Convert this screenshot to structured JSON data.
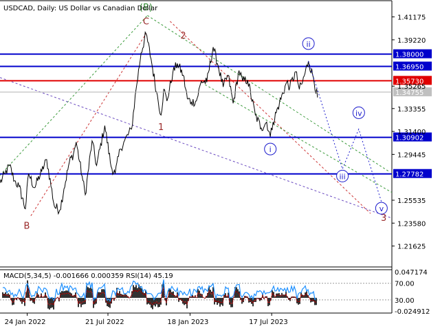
{
  "window": {
    "title": "USDCAD, Daily:  US Dollar vs Canadian Dollar"
  },
  "colors": {
    "price_line": "#000000",
    "blue_level": "#0000cc",
    "red_level": "#e00000",
    "current_price_label": "#c0c0c0",
    "wave_blue": "#1a1acc",
    "wave_red": "#9a2a2a",
    "wave_green": "#2e8b2e",
    "channel_green": "#3a9a3a",
    "channel_purple": "#6a4ac0",
    "channel_red": "#cc3333",
    "macd_hist": "#000000",
    "macd_signal": "#cc0000",
    "rsi_line": "#1e90ff"
  },
  "chart_data": [
    {
      "type": "line",
      "title": "USDCAD, Daily:  US Dollar vs Canadian Dollar",
      "instrument": "USDCAD",
      "timeframe": "Daily",
      "x_ticks": [
        "24 Jan 2022",
        "21 Jul 2022",
        "18 Jan 2023",
        "17 Jul 2023"
      ],
      "xlim": [
        "2021-11-25",
        "2024-04-07"
      ],
      "y_ticks": [
        "1.41175",
        "1.39220",
        "1.35265",
        "1.33355",
        "1.31400",
        "1.29445",
        "1.25535",
        "1.23580",
        "1.21625"
      ],
      "ylim": [
        1.1984,
        1.425
      ],
      "series": [
        {
          "points": [
            [
              "2021-11-25",
              1.27
            ],
            [
              "2021-12-06",
              1.278
            ],
            [
              "2021-12-16",
              1.285
            ],
            [
              "2021-12-27",
              1.272
            ],
            [
              "2022-01-06",
              1.267
            ],
            [
              "2022-01-20",
              1.248
            ],
            [
              "2022-01-27",
              1.278
            ],
            [
              "2022-02-09",
              1.266
            ],
            [
              "2022-02-25",
              1.28
            ],
            [
              "2022-03-08",
              1.29
            ],
            [
              "2022-03-25",
              1.25
            ],
            [
              "2022-04-06",
              1.247
            ],
            [
              "2022-04-15",
              1.265
            ],
            [
              "2022-04-27",
              1.288
            ],
            [
              "2022-05-06",
              1.295
            ],
            [
              "2022-05-12",
              1.305
            ],
            [
              "2022-05-25",
              1.276
            ],
            [
              "2022-06-01",
              1.26
            ],
            [
              "2022-06-16",
              1.306
            ],
            [
              "2022-06-26",
              1.285
            ],
            [
              "2022-07-14",
              1.319
            ],
            [
              "2022-07-28",
              1.284
            ],
            [
              "2022-08-06",
              1.278
            ],
            [
              "2022-08-17",
              1.299
            ],
            [
              "2022-08-25",
              1.305
            ],
            [
              "2022-09-11",
              1.316
            ],
            [
              "2022-09-21",
              1.35
            ],
            [
              "2022-10-02",
              1.381
            ],
            [
              "2022-10-13",
              1.3975
            ],
            [
              "2022-10-24",
              1.376
            ],
            [
              "2022-11-05",
              1.348
            ],
            [
              "2022-11-15",
              1.328
            ],
            [
              "2022-11-21",
              1.35
            ],
            [
              "2022-11-28",
              1.34
            ],
            [
              "2022-12-11",
              1.364
            ],
            [
              "2022-12-21",
              1.372
            ],
            [
              "2023-01-03",
              1.362
            ],
            [
              "2023-01-12",
              1.342
            ],
            [
              "2023-01-21",
              1.339
            ],
            [
              "2023-02-01",
              1.34
            ],
            [
              "2023-02-12",
              1.357
            ],
            [
              "2023-02-24",
              1.356
            ],
            [
              "2023-03-10",
              1.386
            ],
            [
              "2023-03-21",
              1.37
            ],
            [
              "2023-04-01",
              1.352
            ],
            [
              "2023-04-12",
              1.362
            ],
            [
              "2023-04-23",
              1.338
            ],
            [
              "2023-05-06",
              1.366
            ],
            [
              "2023-05-14",
              1.357
            ],
            [
              "2023-05-25",
              1.358
            ],
            [
              "2023-06-11",
              1.328
            ],
            [
              "2023-06-24",
              1.317
            ],
            [
              "2023-07-06",
              1.322
            ],
            [
              "2023-07-14",
              1.3095
            ],
            [
              "2023-07-20",
              1.322
            ],
            [
              "2023-08-03",
              1.338
            ],
            [
              "2023-08-19",
              1.356
            ],
            [
              "2023-08-26",
              1.352
            ],
            [
              "2023-09-08",
              1.365
            ],
            [
              "2023-09-16",
              1.35
            ],
            [
              "2023-09-23",
              1.356
            ],
            [
              "2023-10-06",
              1.374
            ],
            [
              "2023-10-17",
              1.36
            ],
            [
              "2023-10-26",
              1.343
            ]
          ]
        }
      ],
      "current_price": "1.34755",
      "horizontal_levels": [
        {
          "label": "1.38000",
          "value": 1.38,
          "color": "#0000cc",
          "width": 2
        },
        {
          "label": "1.36950",
          "value": 1.3695,
          "color": "#0000cc",
          "width": 2
        },
        {
          "label": "1.35730",
          "value": 1.3573,
          "color": "#e00000",
          "width": 2
        },
        {
          "label": "1.30902",
          "value": 1.30902,
          "color": "#0000cc",
          "width": 2
        },
        {
          "label": "1.27782",
          "value": 1.27782,
          "color": "#0000cc",
          "width": 2
        }
      ],
      "trend_lines": [
        {
          "from": [
            "2021-11-25",
            1.2765
          ],
          "to": [
            "2022-10-16",
            1.413
          ],
          "color": "#3a9a3a"
        },
        {
          "from": [
            "2022-10-16",
            1.413
          ],
          "to": [
            "2024-03-31",
            1.28
          ],
          "color": "#3a9a3a"
        },
        {
          "from": [
            "2021-11-25",
            1.36
          ],
          "to": [
            "2024-04-07",
            1.24
          ],
          "color": "#6a4ac0"
        },
        {
          "from": [
            "2022-02-01",
            1.242
          ],
          "to": [
            "2022-10-13",
            1.3975
          ],
          "color": "#cc3333"
        },
        {
          "from": [
            "2022-12-05",
            1.408
          ],
          "to": [
            "2024-02-20",
            1.244
          ],
          "color": "#cc3333"
        },
        {
          "from": [
            "2023-02-20",
            1.354
          ],
          "to": [
            "2024-04-07",
            1.262
          ],
          "color": "#3a9a3a"
        }
      ],
      "forecast_path": [
        [
          "2023-10-06",
          1.374
        ],
        [
          "2023-12-20",
          1.282
        ],
        [
          "2024-01-25",
          1.316
        ],
        [
          "2024-03-15",
          1.254
        ]
      ],
      "wave_labels": [
        {
          "text": "(B)",
          "x": "2022-10-13",
          "y": 1.42,
          "color": "#2e8b2e",
          "circled": false
        },
        {
          "text": "C",
          "x": "2022-10-13",
          "y": 1.408,
          "color": "#9a2a2a",
          "circled": false
        },
        {
          "text": "2",
          "x": "2023-01-03",
          "y": 1.396,
          "color": "#9a2a2a",
          "circled": false
        },
        {
          "text": "1",
          "x": "2022-11-15",
          "y": 1.318,
          "color": "#9a2a2a",
          "circled": false
        },
        {
          "text": "B",
          "x": "2022-01-23",
          "y": 1.2335,
          "color": "#9a2a2a",
          "circled": false
        },
        {
          "text": "3",
          "x": "2024-03-20",
          "y": 1.2405,
          "color": "#9a2a2a",
          "circled": false
        },
        {
          "text": "i",
          "x": "2023-07-14",
          "y": 1.299,
          "color": "#1a1acc",
          "circled": true
        },
        {
          "text": "ii",
          "x": "2023-10-06",
          "y": 1.389,
          "color": "#1a1acc",
          "circled": true
        },
        {
          "text": "iii",
          "x": "2023-12-20",
          "y": 1.276,
          "color": "#1a1acc",
          "circled": true
        },
        {
          "text": "iv",
          "x": "2024-01-25",
          "y": 1.33,
          "color": "#1a1acc",
          "circled": true
        },
        {
          "text": "v",
          "x": "2024-03-15",
          "y": 1.2485,
          "color": "#1a1acc",
          "circled": true
        }
      ]
    },
    {
      "type": "bar",
      "title": "MACD(5,34,5) -0.001666 0.000359 RSI(14) 45.19",
      "indicator": "MACD(5,34,5)",
      "macd_value": "-0.001666",
      "signal_value": "0.000359",
      "rsi_label": "RSI(14) 45.19",
      "y_ticks": [
        "0.047174",
        "70.00",
        "30.00",
        "-0.024912"
      ],
      "rsi_levels": [
        70,
        30
      ],
      "x_ticks": [
        "24 Jan 2022",
        "21 Jul 2022",
        "18 Jan 2023",
        "17 Jul 2023"
      ]
    }
  ]
}
